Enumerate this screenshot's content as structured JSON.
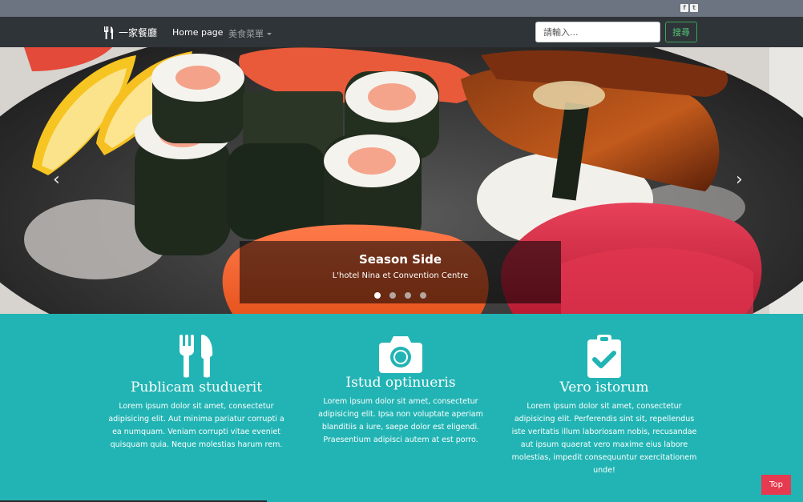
{
  "topbar": {
    "social": [
      {
        "icon": "facebook-icon",
        "glyph": "f"
      },
      {
        "icon": "twitter-icon",
        "glyph": "t"
      }
    ]
  },
  "navbar": {
    "brand": "一家餐廳",
    "home_link": "Home page",
    "menu_dropdown": "美食菜單",
    "search_placeholder": "請輸入...",
    "search_button": "搜尋"
  },
  "carousel": {
    "caption_title": "Season Side",
    "caption_subtitle": "L'hotel Nina et Convention Centre",
    "active_slide": 1,
    "slide_count": 4
  },
  "features": [
    {
      "icon": "fork-knife-icon",
      "title": "Publicam studuerit",
      "text": "Lorem ipsum dolor sit amet, consectetur adipisicing elit. Aut minima pariatur corrupti a ea numquam. Veniam corrupti vitae eveniet quisquam quia. Neque molestias harum rem."
    },
    {
      "icon": "camera-icon",
      "title": "Istud optinueris",
      "text": "Lorem ipsum dolor sit amet, consectetur adipisicing elit. Ipsa non voluptate aperiam blanditiis a iure, saepe dolor est eligendi. Praesentium adipisci autem at est porro."
    },
    {
      "icon": "clipboard-check-icon",
      "title": "Vero istorum",
      "text": "Lorem ipsum dolor sit amet, consectetur adipisicing elit. Perferendis sint sit, repellendus iste veritatis illum laboriosam nobis, recusandae aut ipsum quaerat vero maxime eius labore molestias, impedit consequuntur exercitationem unde!"
    }
  ],
  "top_button": "Top",
  "colors": {
    "accent_teal": "#22b4b4",
    "navbar": "#2f3439",
    "top_button": "#e53a4f",
    "search_green": "#52c172"
  }
}
